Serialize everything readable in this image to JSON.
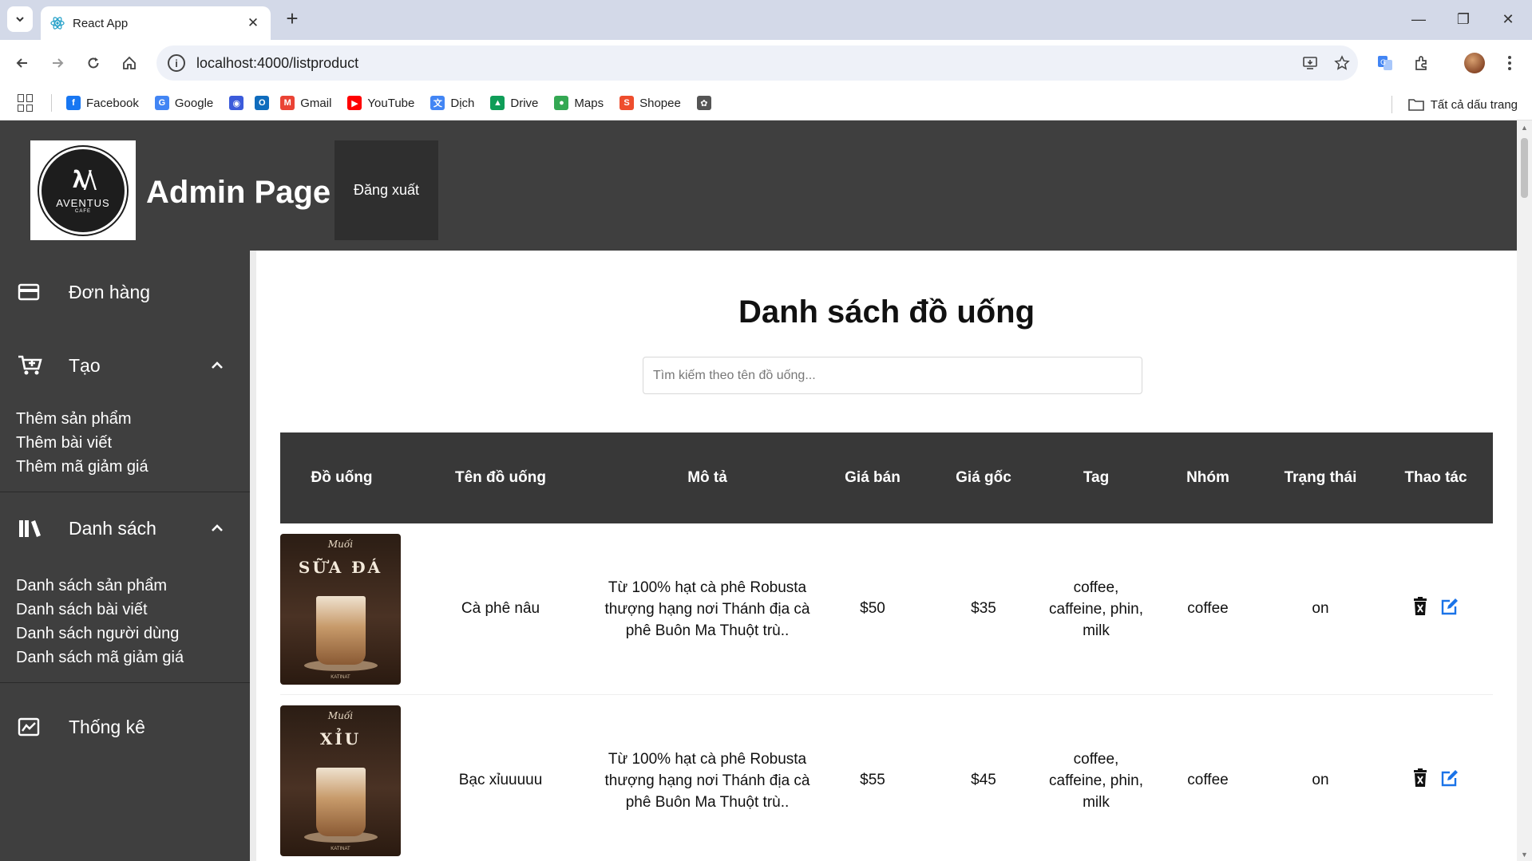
{
  "browser": {
    "tab_title": "React App",
    "url": "localhost:4000/listproduct",
    "bookmarks": [
      {
        "label": "Facebook",
        "icon": "facebook-icon",
        "color": "#1877f2",
        "glyph": "f"
      },
      {
        "label": "Google",
        "icon": "google-icon",
        "color": "#4285f4",
        "glyph": "G"
      },
      {
        "label": "",
        "icon": "site-icon",
        "color": "#3b5bdb",
        "glyph": "◉"
      },
      {
        "label": "",
        "icon": "outlook-icon",
        "color": "#0f6cbd",
        "glyph": "O"
      },
      {
        "label": "Gmail",
        "icon": "gmail-icon",
        "color": "#ea4335",
        "glyph": "M"
      },
      {
        "label": "YouTube",
        "icon": "youtube-icon",
        "color": "#ff0000",
        "glyph": "▶"
      },
      {
        "label": "Dịch",
        "icon": "translate-icon",
        "color": "#4285f4",
        "glyph": "文"
      },
      {
        "label": "Drive",
        "icon": "drive-icon",
        "color": "#0f9d58",
        "glyph": "▲"
      },
      {
        "label": "Maps",
        "icon": "maps-icon",
        "color": "#34a853",
        "glyph": "●"
      },
      {
        "label": "Shopee",
        "icon": "shopee-icon",
        "color": "#ee4d2d",
        "glyph": "S"
      },
      {
        "label": "",
        "icon": "chatgpt-icon",
        "color": "#555555",
        "glyph": "✿"
      }
    ],
    "all_bookmarks": "Tất cả dấu trang"
  },
  "header": {
    "logo_text": "AVENTUS",
    "logo_sub": "CAFE",
    "title": "Admin Page",
    "logout": "Đăng xuất"
  },
  "sidebar": {
    "orders": "Đơn hàng",
    "create": {
      "label": "Tạo",
      "items": [
        "Thêm sản phẩm",
        "Thêm bài viết",
        "Thêm mã giảm giá"
      ]
    },
    "lists": {
      "label": "Danh sách",
      "items": [
        "Danh sách sản phẩm",
        "Danh sách bài viết",
        "Danh sách người dùng",
        "Danh sách mã giảm giá"
      ]
    },
    "stats": "Thống kê"
  },
  "main": {
    "title": "Danh sách đồ uống",
    "search_placeholder": "Tìm kiếm theo tên đồ uống...",
    "columns": [
      "Đồ uống",
      "Tên đồ uống",
      "Mô tả",
      "Giá bán",
      "Giá gốc",
      "Tag",
      "Nhóm",
      "Trạng thái",
      "Thao tác"
    ],
    "rows": [
      {
        "thumb_brand": "Muối",
        "thumb_name": "SỮA ĐÁ",
        "thumb_foot": "KATINAT",
        "name": "Cà phê nâu",
        "description": "Từ 100% hạt cà phê Robusta thượng hạng nơi Thánh địa cà phê Buôn Ma Thuột trù..",
        "price": "$50",
        "original_price": "$35",
        "tags": "coffee, caffeine, phin, milk",
        "group": "coffee",
        "status": "on"
      },
      {
        "thumb_brand": "Muối",
        "thumb_name": "XỈU",
        "thumb_foot": "KATINAT",
        "name": "Bạc xỉuuuuu",
        "description": "Từ 100% hạt cà phê Robusta thượng hạng nơi Thánh địa cà phê Buôn Ma Thuột trù..",
        "price": "$55",
        "original_price": "$45",
        "tags": "coffee, caffeine, phin, milk",
        "group": "coffee",
        "status": "on"
      }
    ]
  }
}
